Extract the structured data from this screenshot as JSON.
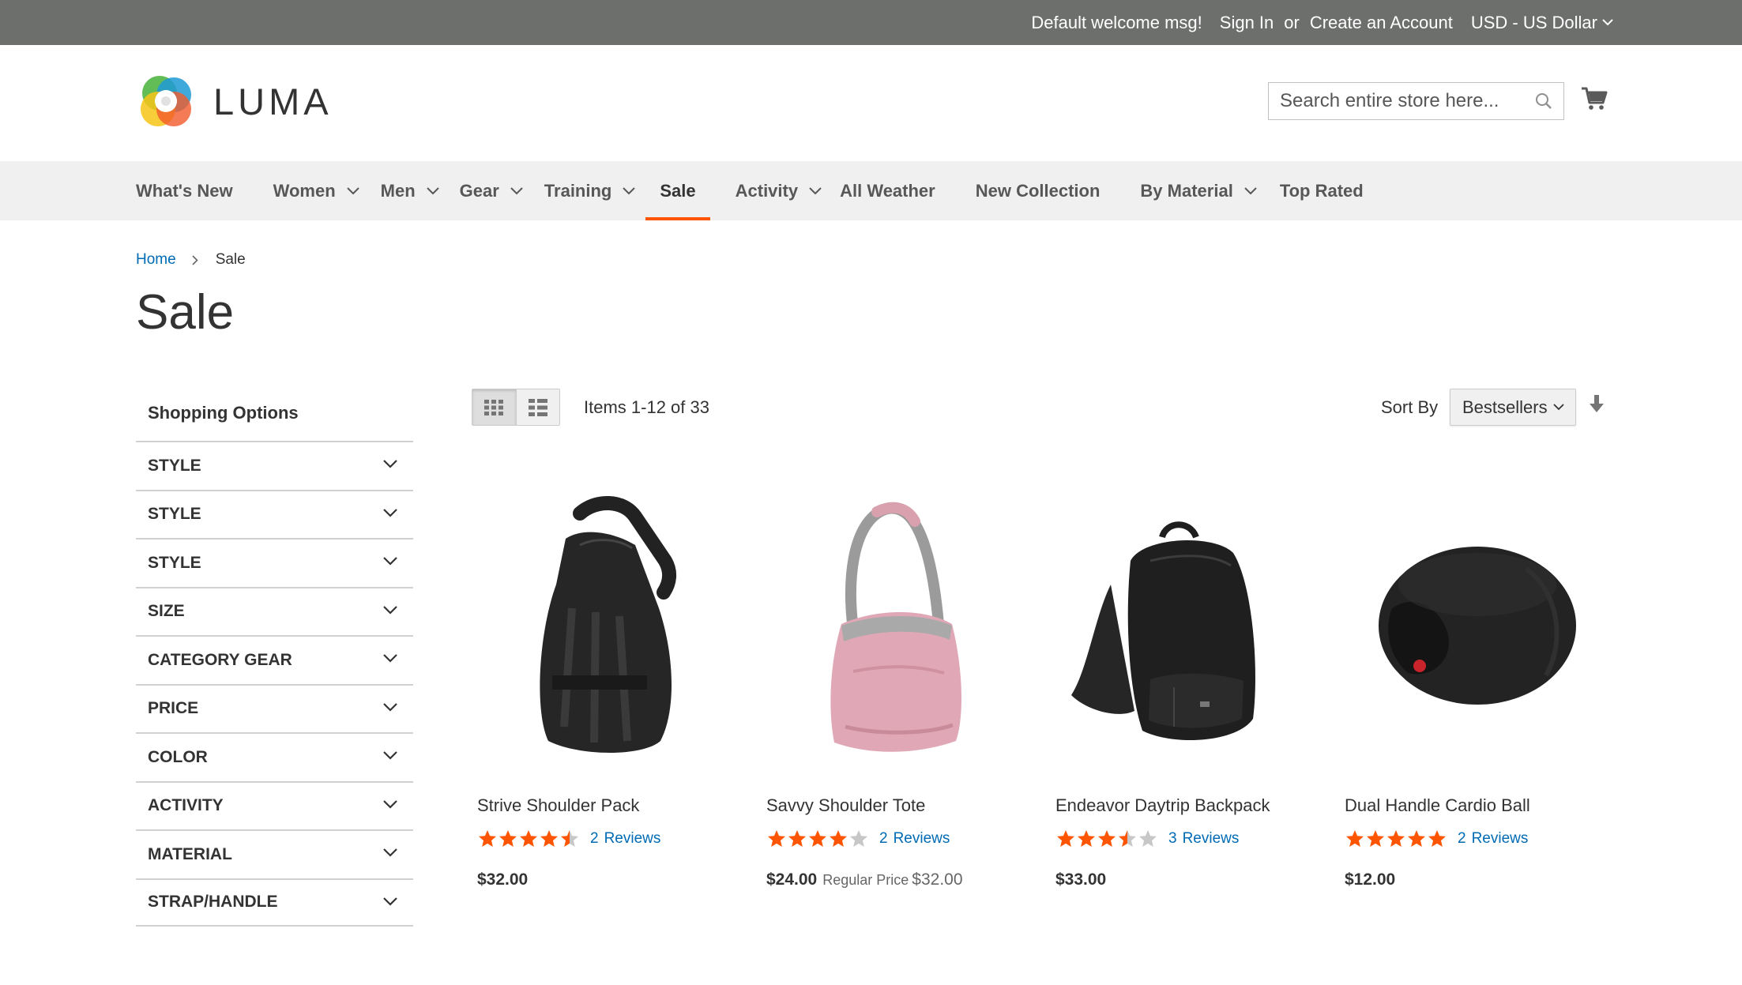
{
  "top_panel": {
    "welcome": "Default welcome msg!",
    "sign_in": "Sign In",
    "or": "or",
    "create_account": "Create an Account",
    "currency": "USD - US Dollar"
  },
  "header": {
    "logo_text": "LUMA",
    "search_placeholder": "Search entire store here..."
  },
  "nav": {
    "items": [
      {
        "label": "What's New",
        "has_dropdown": false
      },
      {
        "label": "Women",
        "has_dropdown": true
      },
      {
        "label": "Men",
        "has_dropdown": true
      },
      {
        "label": "Gear",
        "has_dropdown": true
      },
      {
        "label": "Training",
        "has_dropdown": true
      },
      {
        "label": "Sale",
        "has_dropdown": false,
        "active": true
      },
      {
        "label": "Activity",
        "has_dropdown": true
      },
      {
        "label": "All Weather",
        "has_dropdown": false
      },
      {
        "label": "New Collection",
        "has_dropdown": false
      },
      {
        "label": "By Material",
        "has_dropdown": true
      },
      {
        "label": "Top Rated",
        "has_dropdown": false
      }
    ]
  },
  "breadcrumb": {
    "home": "Home",
    "current": "Sale"
  },
  "page_title": "Sale",
  "sidebar": {
    "title": "Shopping Options",
    "filters": [
      "STYLE",
      "STYLE",
      "STYLE",
      "SIZE",
      "CATEGORY GEAR",
      "PRICE",
      "COLOR",
      "ACTIVITY",
      "MATERIAL",
      "STRAP/HANDLE"
    ]
  },
  "toolbar": {
    "amount": "Items 1-12 of 33",
    "sort_label": "Sort By",
    "sort_value": "Bestsellers",
    "view_mode": "grid"
  },
  "products": [
    {
      "name": "Strive Shoulder Pack",
      "rating_out_of_5": 4.5,
      "review_count": "2",
      "reviews_label": "Reviews",
      "price": "$32.00",
      "regular_price_label": "",
      "regular_price": ""
    },
    {
      "name": "Savvy Shoulder Tote",
      "rating_out_of_5": 4,
      "review_count": "2",
      "reviews_label": "Reviews",
      "price": "$24.00",
      "regular_price_label": "Regular Price",
      "regular_price": "$32.00"
    },
    {
      "name": "Endeavor Daytrip Backpack",
      "rating_out_of_5": 3.5,
      "review_count": "3",
      "reviews_label": "Reviews",
      "price": "$33.00",
      "regular_price_label": "",
      "regular_price": ""
    },
    {
      "name": "Dual Handle Cardio Ball",
      "rating_out_of_5": 5,
      "review_count": "2",
      "reviews_label": "Reviews",
      "price": "$12.00",
      "regular_price_label": "",
      "regular_price": ""
    }
  ],
  "colors": {
    "accent": "#ff5501",
    "link": "#006bb4",
    "top_bar": "#6d6f6d",
    "nav_bg": "#f0f0f0"
  }
}
